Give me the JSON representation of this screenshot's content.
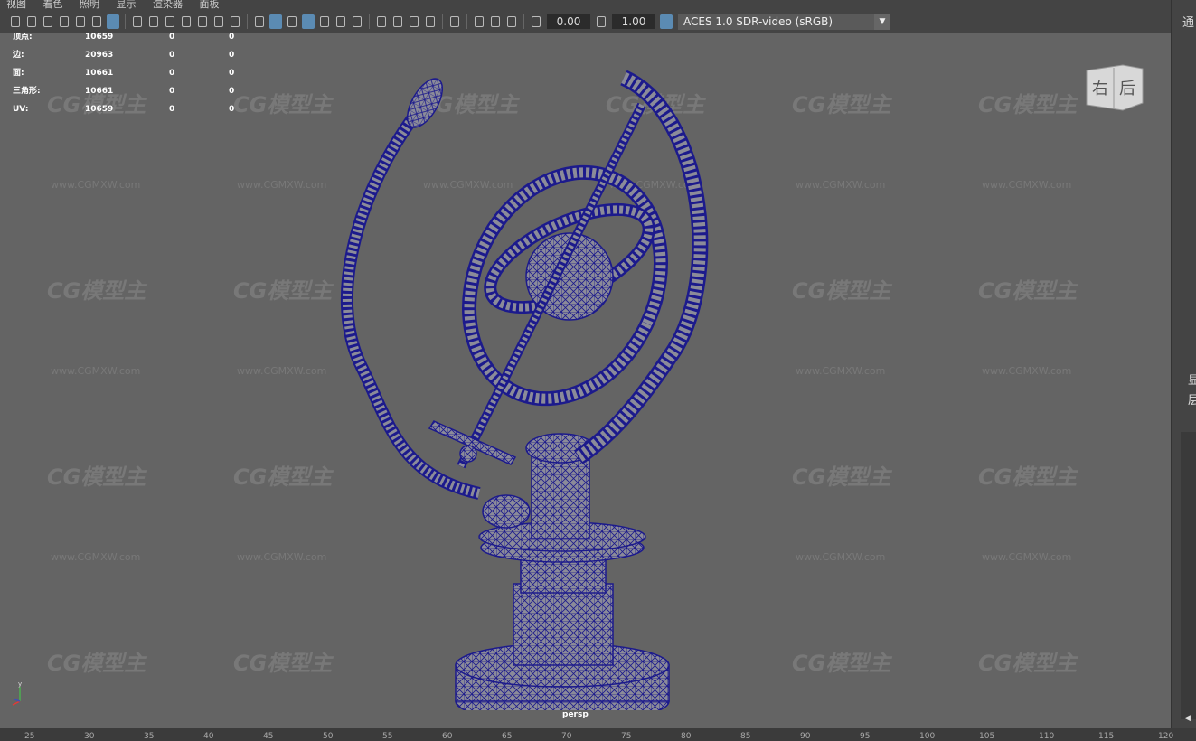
{
  "menubar": {
    "items": [
      "视图",
      "着色",
      "照明",
      "显示",
      "渲染器",
      "面板"
    ]
  },
  "toolbar": {
    "gamma_value": "0.00",
    "exposure_value": "1.00",
    "color_space": "ACES 1.0 SDR-video (sRGB)",
    "color_space_dropdown_icon": "triangle-down"
  },
  "hud": {
    "rows": [
      {
        "label": "顶点:",
        "v1": "10659",
        "v2": "0",
        "v3": "0"
      },
      {
        "label": "边:",
        "v1": "20963",
        "v2": "0",
        "v3": "0"
      },
      {
        "label": "面:",
        "v1": "10661",
        "v2": "0",
        "v3": "0"
      },
      {
        "label": "三角形:",
        "v1": "10661",
        "v2": "0",
        "v3": "0"
      },
      {
        "label": "UV:",
        "v1": "10659",
        "v2": "0",
        "v3": "0"
      }
    ]
  },
  "viewcube": {
    "right_label": "右",
    "back_label": "后"
  },
  "camera_label": "persp",
  "axis": {
    "y": "y",
    "x": "x",
    "z": "z"
  },
  "watermark": {
    "logo": "CG模型主",
    "url": "www.CGMXW.com"
  },
  "right_panel": {
    "title": "通",
    "label1": "显",
    "label2": "层"
  },
  "timeline": {
    "ticks": [
      "25",
      "30",
      "35",
      "40",
      "45",
      "50",
      "55",
      "60",
      "65",
      "70",
      "75",
      "80",
      "85",
      "90",
      "95",
      "100",
      "105",
      "110",
      "115",
      "120"
    ]
  },
  "colors": {
    "viewport_bg": "#646464",
    "wireframe": "#1c1a8c",
    "highlight": "#5b8bb3"
  }
}
